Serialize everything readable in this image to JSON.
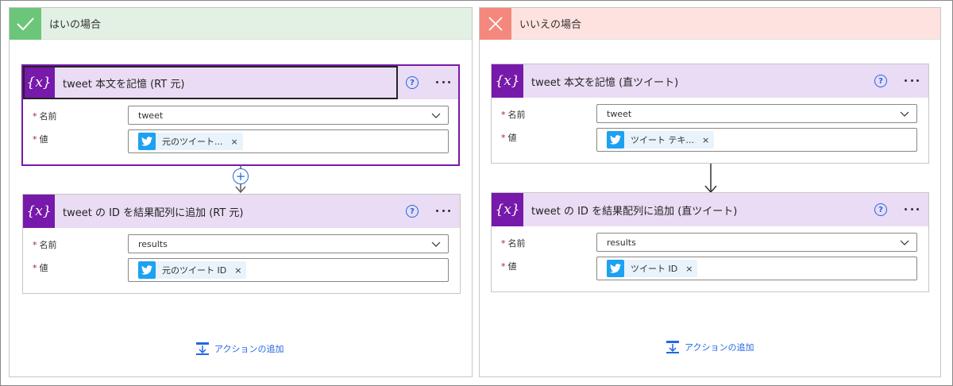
{
  "yes_branch": {
    "title": "はいの場合",
    "card1": {
      "title": "tweet 本文を記憶 (RT 元)",
      "name_label": "名前",
      "name_value": "tweet",
      "value_label": "値",
      "token_text": "元のツイート...",
      "token_remove": "×"
    },
    "card2": {
      "title": "tweet の ID を結果配列に追加 (RT 元)",
      "name_label": "名前",
      "name_value": "results",
      "value_label": "値",
      "token_text": "元のツイート ID",
      "token_remove": "×"
    },
    "add_action": "アクションの追加"
  },
  "no_branch": {
    "title": "いいえの場合",
    "card1": {
      "title": "tweet 本文を記憶 (直ツイート)",
      "name_label": "名前",
      "name_value": "tweet",
      "value_label": "値",
      "token_text": "ツイート テキ...",
      "token_remove": "×"
    },
    "card2": {
      "title": "tweet の ID を結果配列に追加 (直ツイート)",
      "name_label": "名前",
      "name_value": "results",
      "value_label": "値",
      "token_text": "ツイート ID",
      "token_remove": "×"
    },
    "add_action": "アクションの追加"
  },
  "common": {
    "required_mark": "*",
    "variable_icon_text": "{x}",
    "help_icon_text": "?"
  },
  "colors": {
    "yes_accent": "#6cc67a",
    "no_accent": "#f4887d",
    "variable_purple": "#7719aa",
    "twitter_blue": "#1da1f2",
    "link_blue": "#2266e3"
  },
  "icons": {
    "yes": "checkmark-icon",
    "no": "close-icon",
    "variable": "variable-icon",
    "help": "help-icon",
    "more": "more-icon",
    "twitter": "twitter-icon",
    "add_action": "add-action-icon"
  }
}
